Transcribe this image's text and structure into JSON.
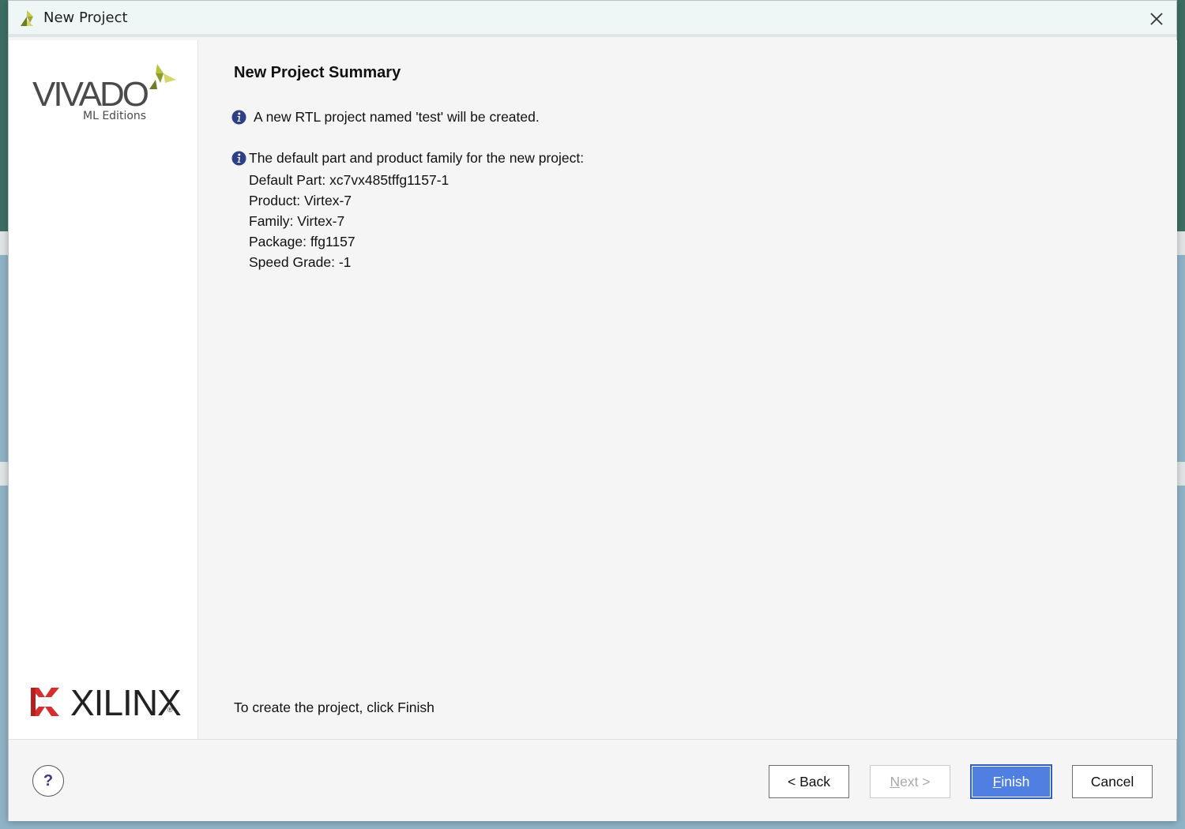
{
  "window": {
    "title": "New Project",
    "close_icon": "close-icon"
  },
  "sidebar": {
    "brand": "VIVADO",
    "brand_sub": "ML Editions",
    "vendor": "XILINX",
    "vendor_reg": "®"
  },
  "content": {
    "heading": "New Project Summary",
    "info1": "A new RTL project named 'test' will be created.",
    "info2": "The default part and product family for the new project:",
    "details": [
      "Default Part: xc7vx485tffg1157-1",
      "Product: Virtex-7",
      "Family: Virtex-7",
      "Package: ffg1157",
      "Speed Grade: -1"
    ],
    "hint": "To create the project, click Finish"
  },
  "buttons": {
    "help": "?",
    "back": "< Back",
    "next_mnemonic": "N",
    "next_rest": "ext >",
    "finish_mnemonic": "F",
    "finish_rest": "inish",
    "cancel": "Cancel"
  },
  "colors": {
    "finish_bg": "#4f7fe0",
    "info_icon": "#2d3f87",
    "xilinx_red": "#d62e2e",
    "vivado_green": "#a9b836"
  }
}
